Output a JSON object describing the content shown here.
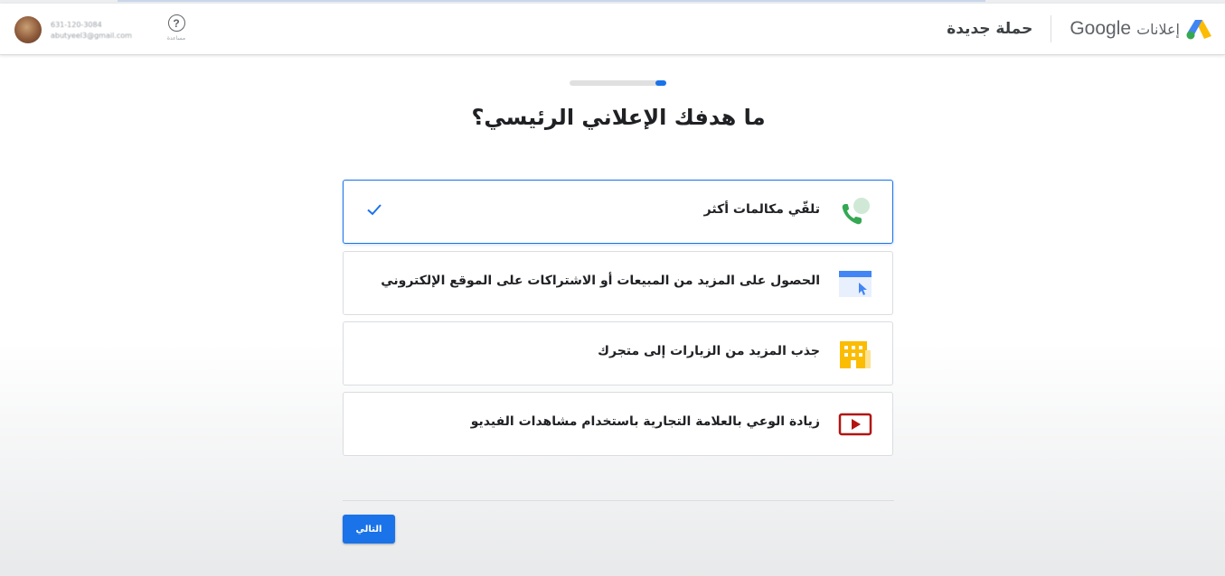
{
  "header": {
    "brand_google": "Google",
    "brand_ads": "إعلانات",
    "page_name": "حملة جديدة",
    "account_phone": "631-120-3084",
    "account_email": "abutyeel3@gmail.com",
    "help_label": "مساعدة"
  },
  "main": {
    "title": "ما هدفك الإعلاني الرئيسي؟",
    "progress": {
      "step": 4,
      "total": 4
    },
    "options": [
      {
        "label": "تلقّي مكالمات أكثر",
        "icon": "phone-call-icon",
        "selected": true
      },
      {
        "label": "الحصول على المزيد من المبيعات أو الاشتراكات على الموقع الإلكتروني",
        "icon": "website-click-icon",
        "selected": false
      },
      {
        "label": "جذب المزيد من الزيارات إلى متجرك",
        "icon": "store-building-icon",
        "selected": false
      },
      {
        "label": "زيادة الوعي بالعلامة التجارية باستخدام مشاهدات الفيديو",
        "icon": "video-play-icon",
        "selected": false
      }
    ],
    "next_label": "التالي"
  },
  "colors": {
    "accent": "#1a73e8",
    "phone_green": "#34a853",
    "store_yellow": "#fbbc04",
    "video_red": "#b31412"
  }
}
